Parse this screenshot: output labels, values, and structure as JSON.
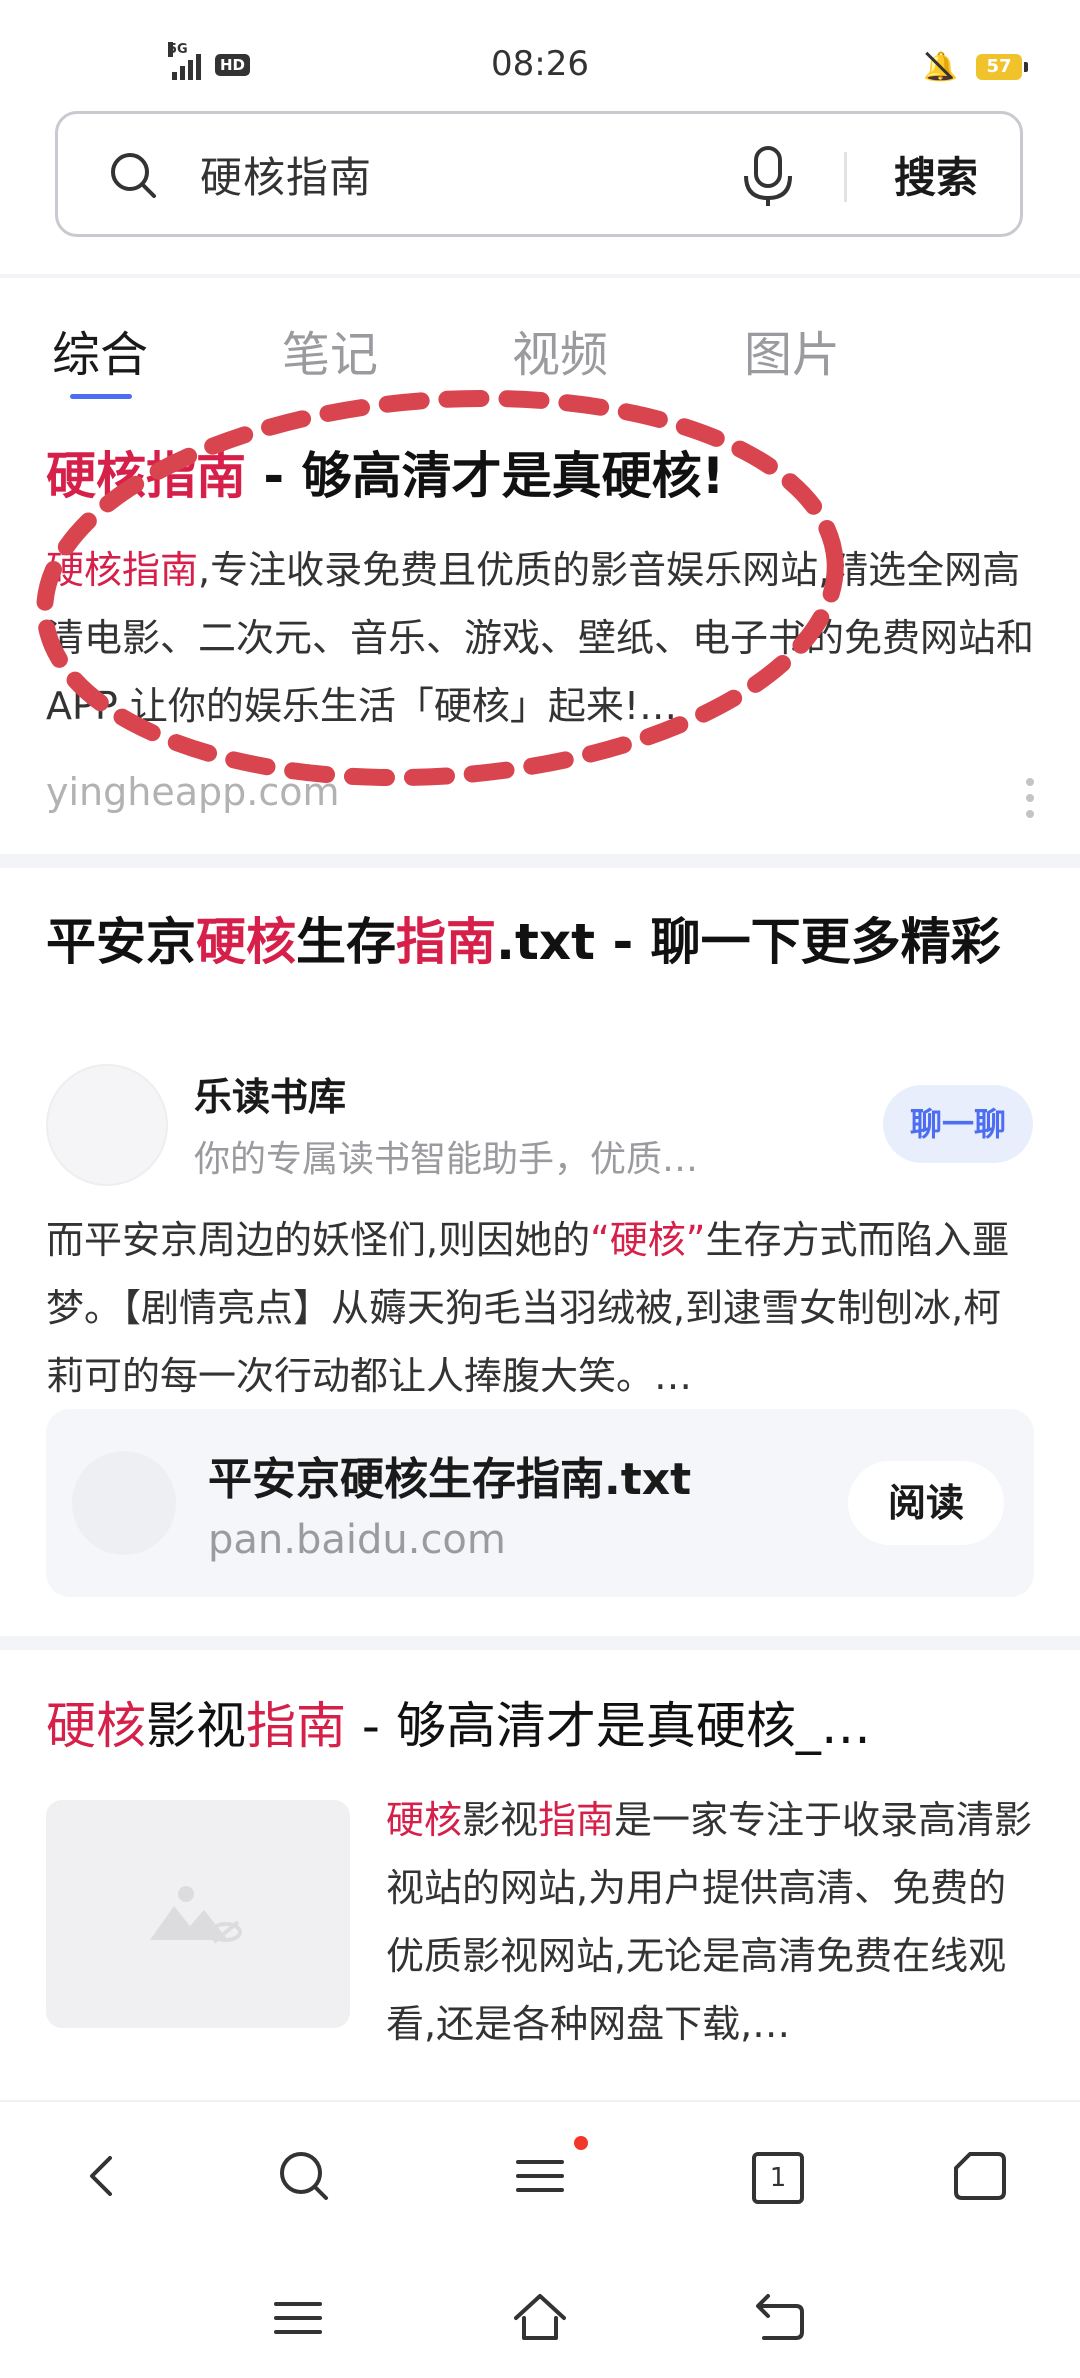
{
  "status_bar": {
    "network": "5G",
    "hd_label": "HD",
    "time": "08:26",
    "battery": "57"
  },
  "search": {
    "query": "硬核指南",
    "submit_label": "搜索"
  },
  "tabs": [
    {
      "label": "综合",
      "active": true
    },
    {
      "label": "笔记",
      "active": false
    },
    {
      "label": "视频",
      "active": false
    },
    {
      "label": "图片",
      "active": false
    }
  ],
  "results": [
    {
      "title_hl": "硬核指南",
      "title_rest": " - 够高清才是真硬核!",
      "body_hl": "硬核指南",
      "body_rest": ",专注收录免费且优质的影音娱乐网站,精选全网高清电影、二次元、音乐、游戏、壁纸、电子书的免费网站和APP,让你的娱乐生活「硬核」起来!…",
      "url": "yingheapp.com"
    },
    {
      "title_p1": "平安京",
      "title_hl1": "硬核",
      "title_p2": "生存",
      "title_hl2": "指南",
      "title_p3": ".txt - 聊一下更多精彩",
      "source_name": "乐读书库",
      "source_desc": "你的专属读书智能助手，优质…",
      "chat_label": "聊一聊",
      "body_p1": "而平安京周边的妖怪们,则因她的",
      "body_hl": "“硬核”",
      "body_p2": "生存方式而陷入噩梦。【剧情亮点】从薅天狗毛当羽绒被,到逮雪女制刨冰,柯莉可的每一次行动都让人捧腹大笑。…",
      "card_title": "平安京硬核生存指南.txt",
      "card_url": "pan.baidu.com",
      "read_label": "阅读"
    },
    {
      "title_hl1": "硬核",
      "title_p1": "影视",
      "title_hl2": "指南",
      "title_p2": " - 够高清才是真硬核_…",
      "body_hl1": "硬核",
      "body_p1": "影视",
      "body_hl2": "指南",
      "body_p2": "是一家专注于收录高清影视站的网站,为用户提供高清、免费的优质影视网站,无论是高清免费在线观看,还是各种网盘下载,…"
    }
  ],
  "bottom_nav": {
    "tab_count": "1"
  },
  "colors": {
    "highlight": "#d6204a",
    "accent": "#4e6ef2",
    "annotation": "#d9454f"
  }
}
